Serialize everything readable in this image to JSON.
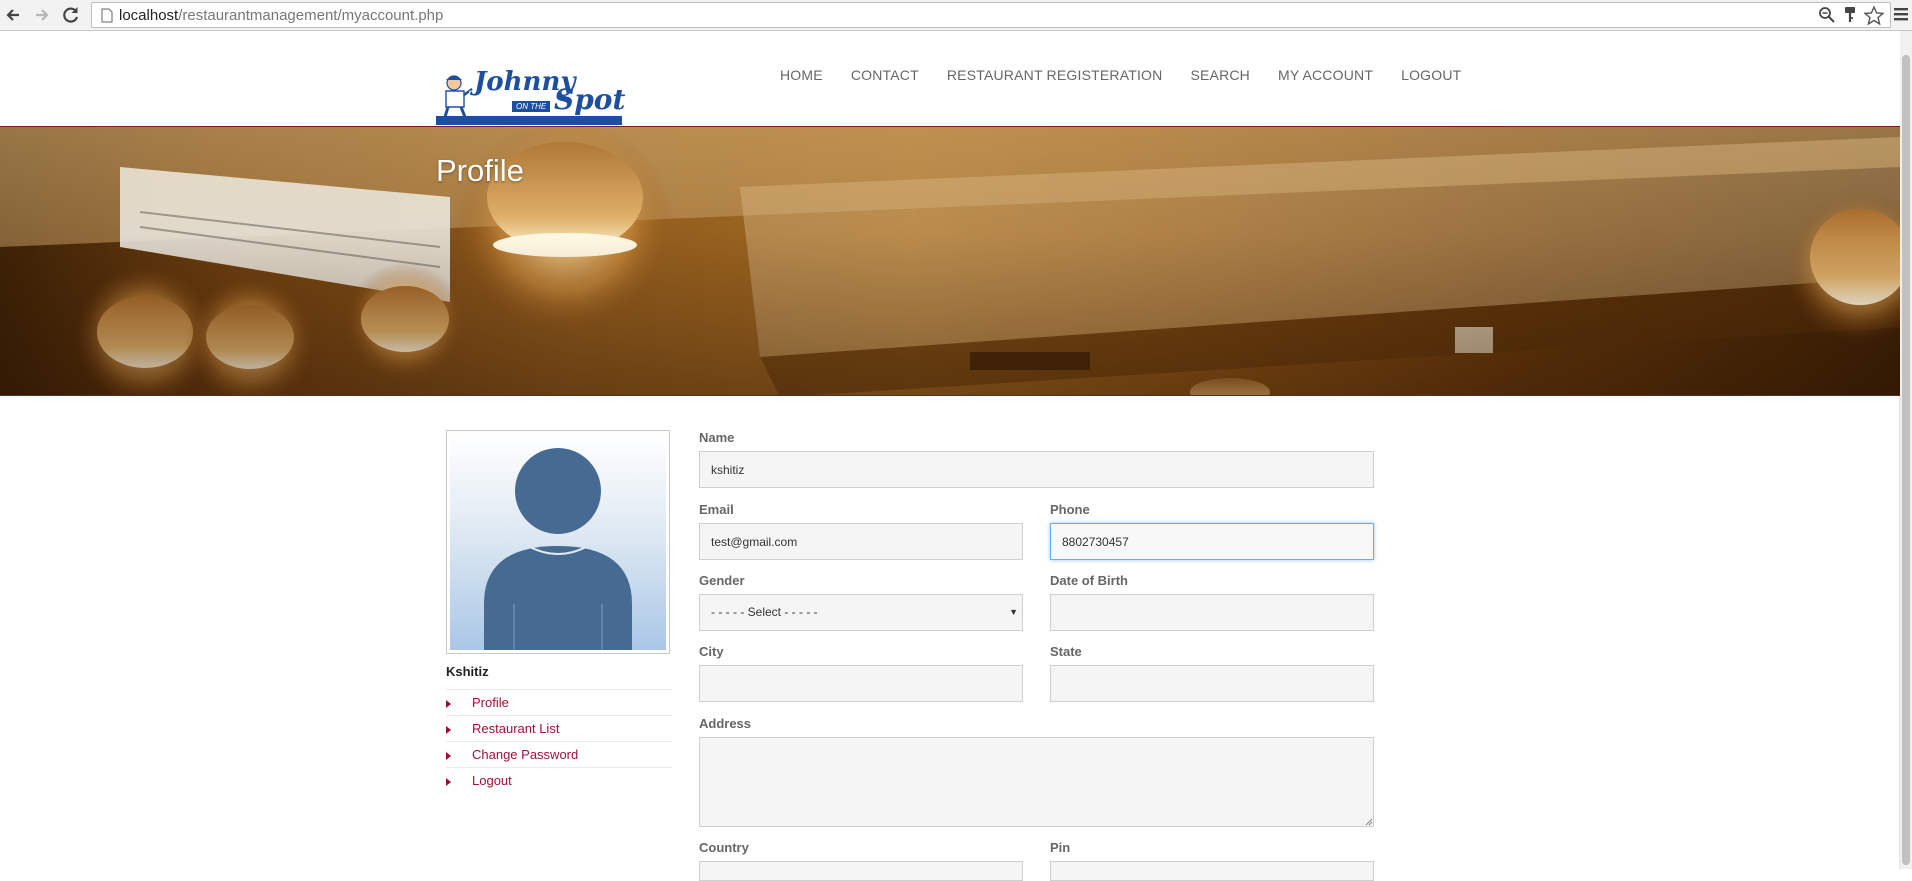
{
  "browser": {
    "url_host": "localhost",
    "url_path": "/restaurantmanagement/myaccount.php"
  },
  "brand": {
    "logo_word1": "Johnny",
    "logo_tag": "ON THE",
    "logo_word2": "Spot",
    "primary_color": "#1d4fa1",
    "accent_color": "#a01237"
  },
  "nav": {
    "items": [
      {
        "label": "HOME"
      },
      {
        "label": "CONTACT"
      },
      {
        "label": "RESTAURANT REGISTERATION"
      },
      {
        "label": "SEARCH"
      },
      {
        "label": "MY ACCOUNT"
      },
      {
        "label": "LOGOUT"
      }
    ]
  },
  "banner": {
    "title": "Profile"
  },
  "sidebar": {
    "user_name": "Kshitiz",
    "items": [
      {
        "label": "Profile"
      },
      {
        "label": "Restaurant List"
      },
      {
        "label": "Change Password"
      },
      {
        "label": "Logout"
      }
    ]
  },
  "form": {
    "name_label": "Name",
    "name_value": "kshitiz",
    "email_label": "Email",
    "email_value": "test@gmail.com",
    "phone_label": "Phone",
    "phone_value": "8802730457",
    "gender_label": "Gender",
    "gender_value": "- - - - - Select - - - - -",
    "dob_label": "Date of Birth",
    "dob_value": "",
    "city_label": "City",
    "city_value": "",
    "state_label": "State",
    "state_value": "",
    "address_label": "Address",
    "address_value": "",
    "country_label": "Country",
    "pin_label": "Pin"
  }
}
